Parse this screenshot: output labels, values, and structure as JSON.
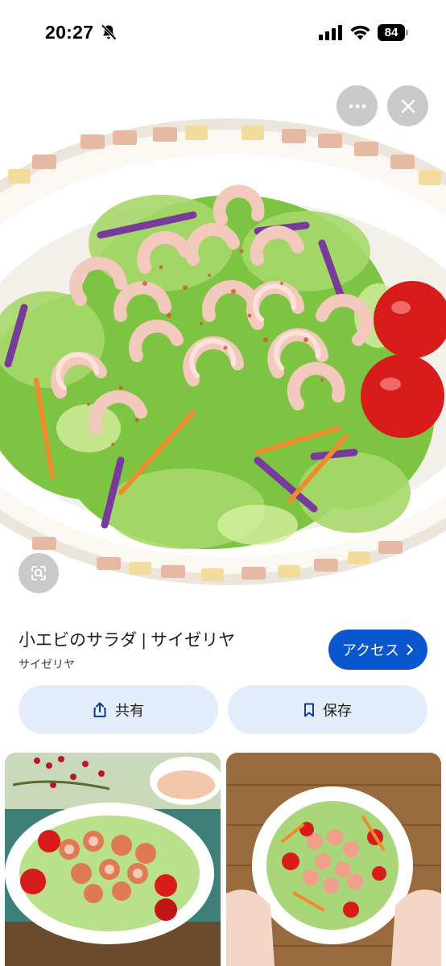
{
  "status_bar": {
    "time": "20:27",
    "battery": "84",
    "icons": [
      "bell-slash-icon",
      "signal-icon",
      "wifi-icon",
      "battery-icon"
    ]
  },
  "hero": {
    "overlay_buttons": [
      "more-icon",
      "close-icon"
    ],
    "lens_button": "lens-icon"
  },
  "result": {
    "title": "小エビのサラダ | サイゼリヤ",
    "source": "サイゼリヤ",
    "access_label": "アクセス"
  },
  "actions": {
    "share_label": "共有",
    "save_label": "保存"
  },
  "colors": {
    "accent": "#0b57d0",
    "pill_bg": "#e3ecfb",
    "overlay_btn": "#c9c9c9"
  }
}
